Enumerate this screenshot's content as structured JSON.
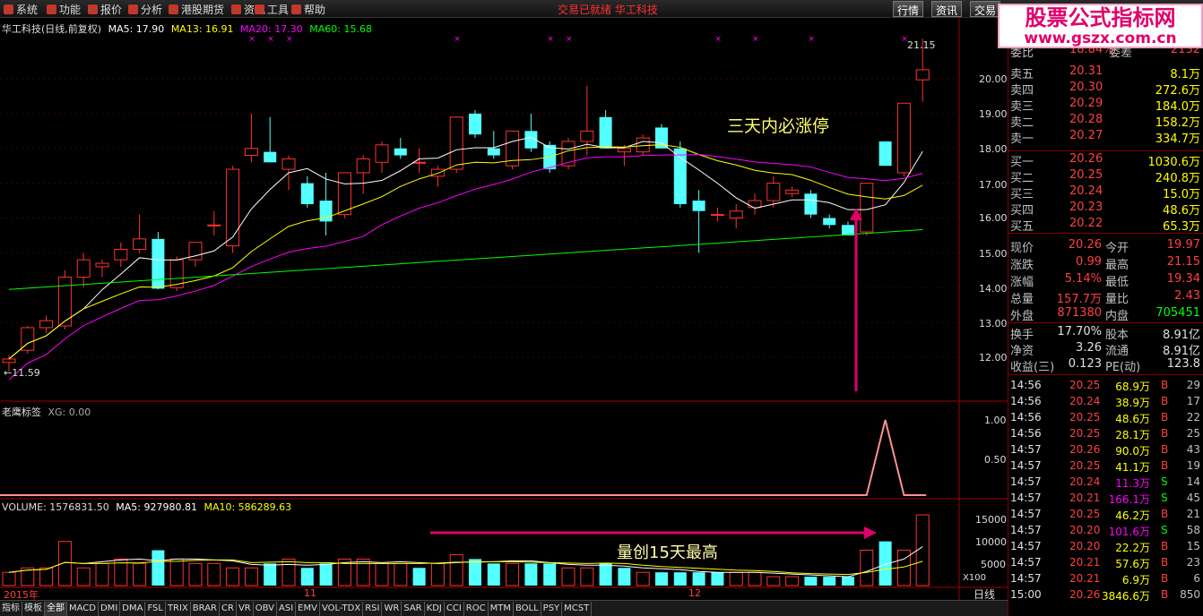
{
  "menu": {
    "items": [
      "系统",
      "功能",
      "报价",
      "分析",
      "港股期货",
      "资讯",
      "工具",
      "帮助"
    ],
    "center_title": "交易已就绪  华工科技",
    "right_tabs": [
      "行情",
      "资讯",
      "交易"
    ]
  },
  "watermark": {
    "line1": "股票公式指标网",
    "line2": "www.gszx.com.cn"
  },
  "main_chart": {
    "title": "华工科技(日线,前复权)",
    "ma5": "MA5: 17.90",
    "ma13": "MA13: 16.91",
    "ma20": "MA20: 17.30",
    "ma60": "MA60: 15.68",
    "high_label": "21.15",
    "low_label": "11.59",
    "annotation": "三天内必涨停",
    "y_ticks": [
      "20.00",
      "19.00",
      "18.00",
      "17.00",
      "16.00",
      "15.00",
      "14.00",
      "13.00",
      "12.00"
    ],
    "colors": {
      "up": "#ff3232",
      "down": "#54ffff",
      "ma5": "#ffffff",
      "ma13": "#ffff00",
      "ma20": "#ff00ff",
      "ma60": "#00ff00",
      "annot": "#e0006a"
    }
  },
  "indicator": {
    "name": "老鹰标签",
    "value": "XG: 0.00",
    "y_ticks": [
      "1.00",
      "0.50"
    ]
  },
  "volume": {
    "label": "VOLUME: 1576831.50",
    "ma5": "MA5: 927980.81",
    "ma10": "MA10: 586289.63",
    "y_ticks": [
      "15000",
      "10000",
      "5000"
    ],
    "unit": "X100",
    "annotation": "量创15天最高"
  },
  "x_axis": {
    "labels": [
      "2015年",
      "11",
      "12"
    ],
    "period": "日线"
  },
  "chart_data": {
    "type": "candlestick",
    "candles": [
      {
        "o": 11.85,
        "h": 12.05,
        "l": 11.59,
        "c": 11.95
      },
      {
        "o": 12.2,
        "h": 12.9,
        "l": 12.1,
        "c": 12.85
      },
      {
        "o": 12.85,
        "h": 13.2,
        "l": 12.7,
        "c": 13.05
      },
      {
        "o": 12.9,
        "h": 14.5,
        "l": 12.8,
        "c": 14.3
      },
      {
        "o": 14.3,
        "h": 15.0,
        "l": 14.0,
        "c": 14.8
      },
      {
        "o": 14.6,
        "h": 14.8,
        "l": 14.3,
        "c": 14.7
      },
      {
        "o": 14.8,
        "h": 15.3,
        "l": 14.6,
        "c": 15.1
      },
      {
        "o": 15.1,
        "h": 16.1,
        "l": 15.0,
        "c": 15.4
      },
      {
        "o": 15.4,
        "h": 15.6,
        "l": 13.95,
        "c": 13.97
      },
      {
        "o": 14.0,
        "h": 14.9,
        "l": 13.9,
        "c": 14.8
      },
      {
        "o": 14.8,
        "h": 15.3,
        "l": 14.6,
        "c": 15.3
      },
      {
        "o": 15.8,
        "h": 16.2,
        "l": 15.5,
        "c": 15.8
      },
      {
        "o": 15.2,
        "h": 17.5,
        "l": 15.0,
        "c": 17.4
      },
      {
        "o": 17.8,
        "h": 19.0,
        "l": 17.6,
        "c": 18.0
      },
      {
        "o": 17.9,
        "h": 18.9,
        "l": 17.6,
        "c": 17.6
      },
      {
        "o": 17.4,
        "h": 17.8,
        "l": 16.8,
        "c": 17.7
      },
      {
        "o": 17.0,
        "h": 17.2,
        "l": 16.3,
        "c": 16.4
      },
      {
        "o": 16.5,
        "h": 17.3,
        "l": 15.5,
        "c": 15.9
      },
      {
        "o": 16.1,
        "h": 17.3,
        "l": 16.0,
        "c": 17.3
      },
      {
        "o": 17.3,
        "h": 17.8,
        "l": 16.7,
        "c": 17.7
      },
      {
        "o": 17.6,
        "h": 18.2,
        "l": 17.3,
        "c": 18.1
      },
      {
        "o": 18.0,
        "h": 18.3,
        "l": 17.7,
        "c": 17.8
      },
      {
        "o": 17.6,
        "h": 18.0,
        "l": 17.3,
        "c": 17.6
      },
      {
        "o": 17.2,
        "h": 17.5,
        "l": 16.9,
        "c": 17.4
      },
      {
        "o": 17.4,
        "h": 18.9,
        "l": 17.3,
        "c": 18.9
      },
      {
        "o": 19.0,
        "h": 19.1,
        "l": 18.3,
        "c": 18.4
      },
      {
        "o": 18.0,
        "h": 18.5,
        "l": 17.7,
        "c": 17.8
      },
      {
        "o": 17.5,
        "h": 18.5,
        "l": 17.4,
        "c": 18.5
      },
      {
        "o": 18.5,
        "h": 19.0,
        "l": 17.9,
        "c": 18.0
      },
      {
        "o": 18.1,
        "h": 18.2,
        "l": 17.3,
        "c": 17.4
      },
      {
        "o": 17.5,
        "h": 18.3,
        "l": 17.4,
        "c": 18.2
      },
      {
        "o": 18.2,
        "h": 19.8,
        "l": 17.8,
        "c": 18.5
      },
      {
        "o": 18.9,
        "h": 19.1,
        "l": 18.0,
        "c": 18.0
      },
      {
        "o": 17.9,
        "h": 18.1,
        "l": 17.5,
        "c": 18.0
      },
      {
        "o": 17.9,
        "h": 18.4,
        "l": 17.8,
        "c": 18.3
      },
      {
        "o": 18.6,
        "h": 18.7,
        "l": 18.0,
        "c": 18.0
      },
      {
        "o": 18.0,
        "h": 18.2,
        "l": 16.3,
        "c": 16.4
      },
      {
        "o": 16.5,
        "h": 16.8,
        "l": 15.0,
        "c": 16.2
      },
      {
        "o": 16.1,
        "h": 16.3,
        "l": 15.9,
        "c": 16.1
      },
      {
        "o": 16.0,
        "h": 16.4,
        "l": 15.7,
        "c": 16.2
      },
      {
        "o": 16.3,
        "h": 16.7,
        "l": 16.1,
        "c": 16.5
      },
      {
        "o": 16.5,
        "h": 17.2,
        "l": 16.3,
        "c": 17.0
      },
      {
        "o": 16.7,
        "h": 16.9,
        "l": 16.6,
        "c": 16.8
      },
      {
        "o": 16.7,
        "h": 16.8,
        "l": 16.0,
        "c": 16.1
      },
      {
        "o": 16.0,
        "h": 16.1,
        "l": 15.7,
        "c": 15.8
      },
      {
        "o": 15.8,
        "h": 15.9,
        "l": 15.5,
        "c": 15.5
      },
      {
        "o": 15.6,
        "h": 17.0,
        "l": 15.5,
        "c": 17.0
      },
      {
        "o": 18.2,
        "h": 18.2,
        "l": 17.5,
        "c": 17.5
      },
      {
        "o": 17.3,
        "h": 19.3,
        "l": 17.2,
        "c": 19.3
      },
      {
        "o": 19.97,
        "h": 21.15,
        "l": 19.34,
        "c": 20.26
      }
    ],
    "volume": [
      3,
      4,
      4,
      10,
      4,
      5,
      6,
      5,
      8,
      6,
      5,
      5,
      4,
      4,
      5,
      6,
      4,
      5,
      6,
      6,
      5,
      5,
      4,
      5,
      7,
      6,
      5,
      5,
      5,
      5,
      4,
      4,
      5,
      4,
      3,
      3,
      3,
      3,
      3,
      3,
      3,
      2,
      2,
      2,
      2,
      2,
      8,
      10,
      8,
      16
    ],
    "volume_up_red": [
      true,
      true,
      true,
      true,
      true,
      true,
      true,
      true,
      false,
      true,
      true,
      true,
      true,
      true,
      false,
      true,
      false,
      false,
      true,
      true,
      true,
      true,
      false,
      true,
      true,
      false,
      false,
      true,
      false,
      false,
      true,
      true,
      false,
      false,
      true,
      false,
      false,
      false,
      false,
      true,
      true,
      true,
      true,
      false,
      false,
      false,
      true,
      false,
      true,
      true
    ]
  },
  "quote": {
    "header": [
      "委比",
      "18.84%",
      "委差",
      "2132"
    ],
    "sell": [
      {
        "label": "卖五",
        "price": "20.31",
        "vol": "8.1万"
      },
      {
        "label": "卖四",
        "price": "20.30",
        "vol": "272.6万"
      },
      {
        "label": "卖三",
        "price": "20.29",
        "vol": "184.0万"
      },
      {
        "label": "卖二",
        "price": "20.28",
        "vol": "158.2万"
      },
      {
        "label": "卖一",
        "price": "20.27",
        "vol": "334.7万"
      }
    ],
    "buy": [
      {
        "label": "买一",
        "price": "20.26",
        "vol": "1030.6万"
      },
      {
        "label": "买二",
        "price": "20.25",
        "vol": "240.8万"
      },
      {
        "label": "买三",
        "price": "20.24",
        "vol": "15.0万"
      },
      {
        "label": "买四",
        "price": "20.23",
        "vol": "48.6万"
      },
      {
        "label": "买五",
        "price": "20.22",
        "vol": "65.3万"
      }
    ],
    "stats": [
      {
        "k1": "现价",
        "v1": "20.26",
        "k2": "今开",
        "v2": "19.97"
      },
      {
        "k1": "涨跌",
        "v1": "0.99",
        "k2": "最高",
        "v2": "21.15"
      },
      {
        "k1": "涨幅",
        "v1": "5.14%",
        "k2": "最低",
        "v2": "19.34"
      },
      {
        "k1": "总量",
        "v1": "157.7万",
        "k2": "量比",
        "v2": "2.43"
      },
      {
        "k1": "外盘",
        "v1": "871380",
        "k2": "内盘",
        "v2": "705451"
      }
    ],
    "stats2": [
      {
        "k1": "换手",
        "v1": "17.70%",
        "k2": "股本",
        "v2": "8.91亿"
      },
      {
        "k1": "净资",
        "v1": "3.26",
        "k2": "流通",
        "v2": "8.91亿"
      },
      {
        "k1": "收益(三)",
        "v1": "0.123",
        "k2": "PE(动)",
        "v2": "123.8"
      }
    ],
    "ticks": [
      {
        "t": "14:56",
        "p": "20.25",
        "v": "68.9万",
        "s": "B",
        "n": "29"
      },
      {
        "t": "14:56",
        "p": "20.24",
        "v": "38.9万",
        "s": "B",
        "n": "17"
      },
      {
        "t": "14:56",
        "p": "20.25",
        "v": "48.6万",
        "s": "B",
        "n": "22"
      },
      {
        "t": "14:56",
        "p": "20.25",
        "v": "28.1万",
        "s": "B",
        "n": "25"
      },
      {
        "t": "14:57",
        "p": "20.26",
        "v": "90.0万",
        "s": "B",
        "n": "43"
      },
      {
        "t": "14:57",
        "p": "20.25",
        "v": "41.1万",
        "s": "B",
        "n": "19"
      },
      {
        "t": "14:57",
        "p": "20.24",
        "v": "11.3万",
        "s": "S",
        "n": "14"
      },
      {
        "t": "14:57",
        "p": "20.21",
        "v": "166.1万",
        "s": "S",
        "n": "45"
      },
      {
        "t": "14:57",
        "p": "20.25",
        "v": "46.2万",
        "s": "B",
        "n": "21"
      },
      {
        "t": "14:57",
        "p": "20.20",
        "v": "101.6万",
        "s": "S",
        "n": "58"
      },
      {
        "t": "14:57",
        "p": "20.20",
        "v": "22.2万",
        "s": "B",
        "n": "15"
      },
      {
        "t": "14:57",
        "p": "20.21",
        "v": "57.6万",
        "s": "B",
        "n": "23"
      },
      {
        "t": "14:57",
        "p": "20.21",
        "v": "6.9万",
        "s": "B",
        "n": "6"
      },
      {
        "t": "15:00",
        "p": "20.26",
        "v": "3846.6万",
        "s": "B",
        "n": "850"
      }
    ]
  },
  "bottom_tabs": [
    "指标",
    "模板",
    "全部",
    "MACD",
    "DMI",
    "DMA",
    "FSL",
    "TRIX",
    "BRAR",
    "CR",
    "VR",
    "OBV",
    "ASI",
    "EMV",
    "VOL-TDX",
    "RSI",
    "WR",
    "SAR",
    "KDJ",
    "CCI",
    "ROC",
    "MTM",
    "BOLL",
    "PSY",
    "MCST"
  ]
}
